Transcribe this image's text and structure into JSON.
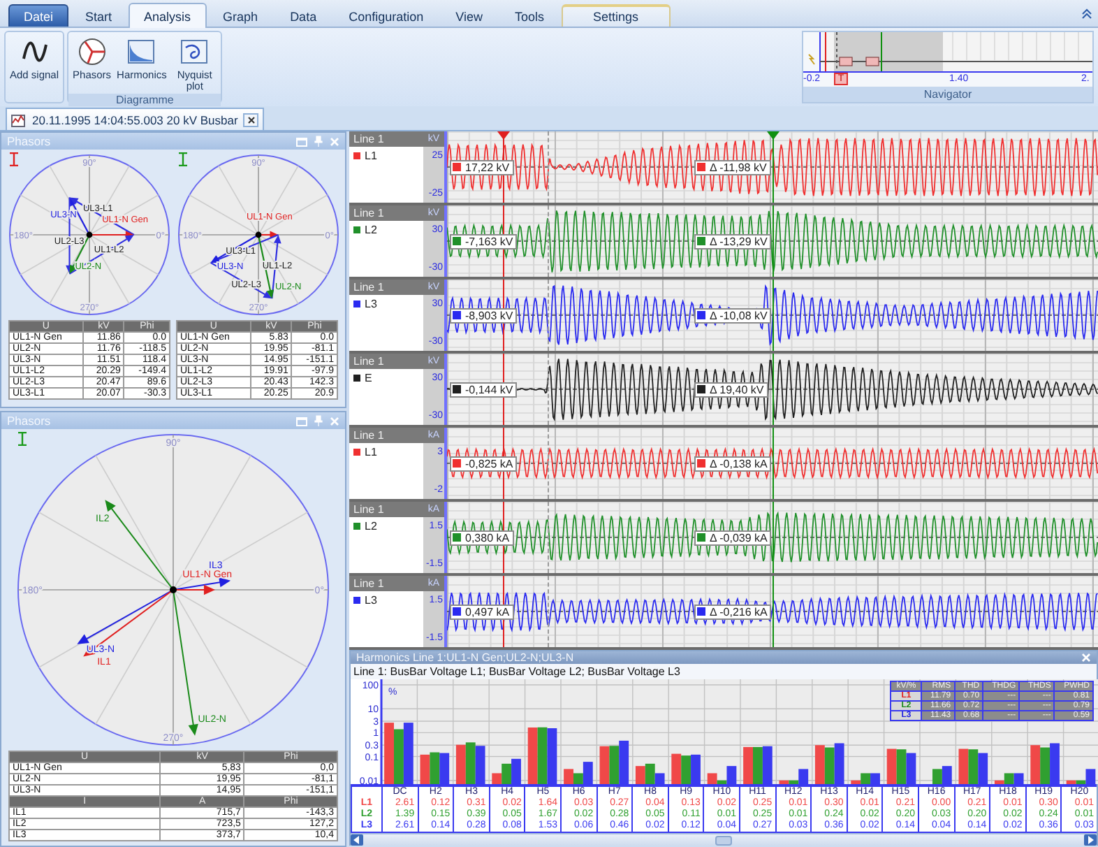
{
  "ribbon": {
    "tabs": [
      {
        "label": "Datei",
        "kind": "app",
        "selected": false
      },
      {
        "label": "Start",
        "kind": "tab",
        "selected": false
      },
      {
        "label": "Analysis",
        "kind": "tab",
        "selected": true
      },
      {
        "label": "Graph",
        "kind": "tab",
        "selected": false
      },
      {
        "label": "Data",
        "kind": "tab",
        "selected": false
      },
      {
        "label": "Configuration",
        "kind": "tab",
        "selected": false
      },
      {
        "label": "View",
        "kind": "tab",
        "selected": false
      },
      {
        "label": "Tools",
        "kind": "tab",
        "selected": false
      },
      {
        "label": "Settings",
        "kind": "contextual",
        "selected": false
      }
    ],
    "groups": [
      {
        "buttons": [
          "Add signal"
        ]
      },
      {
        "title": "Diagramme",
        "buttons": [
          "Phasors",
          "Harmonics",
          "Nyquist plot"
        ]
      }
    ],
    "navigator": {
      "title": "Navigator",
      "start": "-0.2",
      "trigger": "T",
      "mid": "1.40",
      "end": "2."
    }
  },
  "document_tab": {
    "label": "20.11.1995 14:04:55.003 20 kV Busbar"
  },
  "phasor_panels": [
    {
      "title": "Phasors",
      "diagrams": [
        {
          "color": "#e02020",
          "angle_labels": [
            "90°",
            "180°",
            "0°",
            "270°"
          ],
          "vectors": [
            {
              "label": "UL3-N",
              "color": "#2020e0"
            },
            {
              "label": "UL3-L1",
              "color": "#202020"
            },
            {
              "label": "UL1-N Gen",
              "color": "#e02020"
            },
            {
              "label": "UL2-L3",
              "color": "#202020"
            },
            {
              "label": "UL1-L2",
              "color": "#202020"
            },
            {
              "label": "UL2-N",
              "color": "#1a8a1a"
            }
          ]
        },
        {
          "color": "#1a9a1a",
          "angle_labels": [
            "90°",
            "180°",
            "0°",
            "270°"
          ],
          "vectors": [
            {
              "label": "UL1-N Gen",
              "color": "#e02020"
            },
            {
              "label": "UL3-L1",
              "color": "#202020"
            },
            {
              "label": "UL3-N",
              "color": "#2020e0"
            },
            {
              "label": "UL1-L2",
              "color": "#202020"
            },
            {
              "label": "UL2-L3",
              "color": "#202020"
            },
            {
              "label": "UL2-N",
              "color": "#1a8a1a"
            }
          ]
        }
      ],
      "tables": [
        {
          "sections": [
            {
              "columns": [
                "U",
                "kV",
                "Phi"
              ],
              "rows": [
                [
                  "UL1-N Gen",
                  "11.86",
                  "0.0"
                ],
                [
                  "UL2-N",
                  "11.76",
                  "-118.5"
                ],
                [
                  "UL3-N",
                  "11.51",
                  "118.4"
                ],
                [
                  "UL1-L2",
                  "20.29",
                  "-149.4"
                ],
                [
                  "UL2-L3",
                  "20.47",
                  "89.6"
                ],
                [
                  "UL3-L1",
                  "20.07",
                  "-30.3"
                ]
              ]
            }
          ]
        },
        {
          "sections": [
            {
              "columns": [
                "U",
                "kV",
                "Phi"
              ],
              "rows": [
                [
                  "UL1-N Gen",
                  "5.83",
                  "0.0"
                ],
                [
                  "UL2-N",
                  "19.95",
                  "-81.1"
                ],
                [
                  "UL3-N",
                  "14.95",
                  "-151.1"
                ],
                [
                  "UL1-L2",
                  "19.91",
                  "-97.9"
                ],
                [
                  "UL2-L3",
                  "20.43",
                  "142.3"
                ],
                [
                  "UL3-L1",
                  "20.25",
                  "20.9"
                ]
              ]
            }
          ]
        }
      ]
    },
    {
      "title": "Phasors",
      "diagrams": [
        {
          "color": "#1a9a1a",
          "angle_labels": [
            "90°",
            "180°",
            "0°",
            "270°"
          ],
          "vectors": [
            {
              "label": "IL2",
              "color": "#1a8a1a"
            },
            {
              "label": "IL3",
              "color": "#2020e0"
            },
            {
              "label": "UL1-N Gen",
              "color": "#e02020"
            },
            {
              "label": "UL3-N",
              "color": "#2020e0"
            },
            {
              "label": "IL1",
              "color": "#e02020"
            },
            {
              "label": "UL2-N",
              "color": "#1a8a1a"
            }
          ]
        }
      ],
      "tables": [
        {
          "sections": [
            {
              "columns": [
                "U",
                "kV",
                "Phi"
              ],
              "rows": [
                [
                  "UL1-N Gen",
                  "5,83",
                  "0,0"
                ],
                [
                  "UL2-N",
                  "19,95",
                  "-81,1"
                ],
                [
                  "UL3-N",
                  "14,95",
                  "-151,1"
                ]
              ]
            },
            {
              "columns": [
                "I",
                "A",
                "Phi"
              ],
              "rows": [
                [
                  "IL1",
                  "715,7",
                  "-143,3"
                ],
                [
                  "IL2",
                  "723,5",
                  "127,2"
                ],
                [
                  "IL3",
                  "373,7",
                  "10,4"
                ]
              ]
            }
          ]
        }
      ]
    }
  ],
  "waveforms": {
    "cursors": [
      {
        "color": "#e02020"
      },
      {
        "color": "#109010"
      }
    ],
    "traces": [
      {
        "group": "Line 1",
        "channel": "L1",
        "color": "#f03030",
        "unit": "kV",
        "ticks": [
          "25",
          "-25"
        ],
        "cursor_value": "17,22 kV",
        "delta_value": "Δ -11,98 kV"
      },
      {
        "group": "Line 1",
        "channel": "L2",
        "color": "#20902a",
        "unit": "kV",
        "ticks": [
          "30",
          "-30"
        ],
        "cursor_value": "-7,163 kV",
        "delta_value": "Δ -13,29 kV"
      },
      {
        "group": "Line 1",
        "channel": "L3",
        "color": "#2a2af0",
        "unit": "kV",
        "ticks": [
          "30",
          "-30"
        ],
        "cursor_value": "-8,903 kV",
        "delta_value": "Δ -10,08 kV"
      },
      {
        "group": "Line 1",
        "channel": "E",
        "color": "#202020",
        "unit": "kV",
        "ticks": [
          "30",
          "-30"
        ],
        "cursor_value": "-0,144 kV",
        "delta_value": "Δ 19,40 kV"
      },
      {
        "group": "Line 1",
        "channel": "L1",
        "color": "#f03030",
        "unit": "kA",
        "ticks": [
          "3",
          "-2"
        ],
        "cursor_value": "-0,825 kA",
        "delta_value": "Δ -0,138 kA"
      },
      {
        "group": "Line 1",
        "channel": "L2",
        "color": "#20902a",
        "unit": "kA",
        "ticks": [
          "1.5",
          "-1.5"
        ],
        "cursor_value": "0,380 kA",
        "delta_value": "Δ -0,039 kA"
      },
      {
        "group": "Line 1",
        "channel": "L3",
        "color": "#2a2af0",
        "unit": "kA",
        "ticks": [
          "1.5",
          "-1.5"
        ],
        "cursor_value": "0,497 kA",
        "delta_value": "Δ -0,216 kA"
      }
    ]
  },
  "harmonics": {
    "title": "Harmonics Line 1:UL1-N Gen;UL2-N;UL3-N",
    "subtitle": "Line 1: BusBar Voltage L1; BusBar Voltage L2; BusBar Voltage L3",
    "axis": {
      "unit": "%",
      "ticks": [
        "100",
        "10",
        "3",
        "1",
        "0.3",
        "0.1",
        "0.01"
      ]
    },
    "table": {
      "columns": [
        "DC",
        "H2",
        "H3",
        "H4",
        "H5",
        "H6",
        "H7",
        "H8",
        "H9",
        "H10",
        "H11",
        "H12",
        "H13",
        "H14",
        "H15",
        "H16",
        "H17",
        "H18",
        "H19",
        "H20"
      ],
      "rows": [
        {
          "label": "L1",
          "color": "#f04848",
          "values": [
            "2.61",
            "0.12",
            "0.31",
            "0.02",
            "1.64",
            "0.03",
            "0.27",
            "0.04",
            "0.13",
            "0.02",
            "0.25",
            "0.01",
            "0.30",
            "0.01",
            "0.21",
            "0.00",
            "0.21",
            "0.01",
            "0.30",
            "0.01"
          ]
        },
        {
          "label": "L2",
          "color": "#30a030",
          "values": [
            "1.39",
            "0.15",
            "0.39",
            "0.05",
            "1.67",
            "0.02",
            "0.28",
            "0.05",
            "0.11",
            "0.01",
            "0.25",
            "0.01",
            "0.24",
            "0.02",
            "0.20",
            "0.03",
            "0.20",
            "0.02",
            "0.24",
            "0.01"
          ]
        },
        {
          "label": "L3",
          "color": "#3a3af0",
          "values": [
            "2.61",
            "0.14",
            "0.28",
            "0.08",
            "1.53",
            "0.06",
            "0.46",
            "0.02",
            "0.12",
            "0.04",
            "0.27",
            "0.03",
            "0.36",
            "0.02",
            "0.14",
            "0.04",
            "0.14",
            "0.02",
            "0.36",
            "0.03"
          ]
        }
      ]
    },
    "summary": {
      "columns": [
        "kV/%",
        "RMS",
        "THD",
        "THDG",
        "THDS",
        "PWHD"
      ],
      "rows": [
        {
          "label": "L1",
          "color": "#e02020",
          "values": [
            "11.79",
            "0.70",
            "---",
            "---",
            "0.81"
          ]
        },
        {
          "label": "L2",
          "color": "#1a8a1a",
          "values": [
            "11.66",
            "0.72",
            "---",
            "---",
            "0.79"
          ]
        },
        {
          "label": "L3",
          "color": "#2020e0",
          "values": [
            "11.43",
            "0.68",
            "---",
            "---",
            "0.59"
          ]
        }
      ]
    }
  }
}
